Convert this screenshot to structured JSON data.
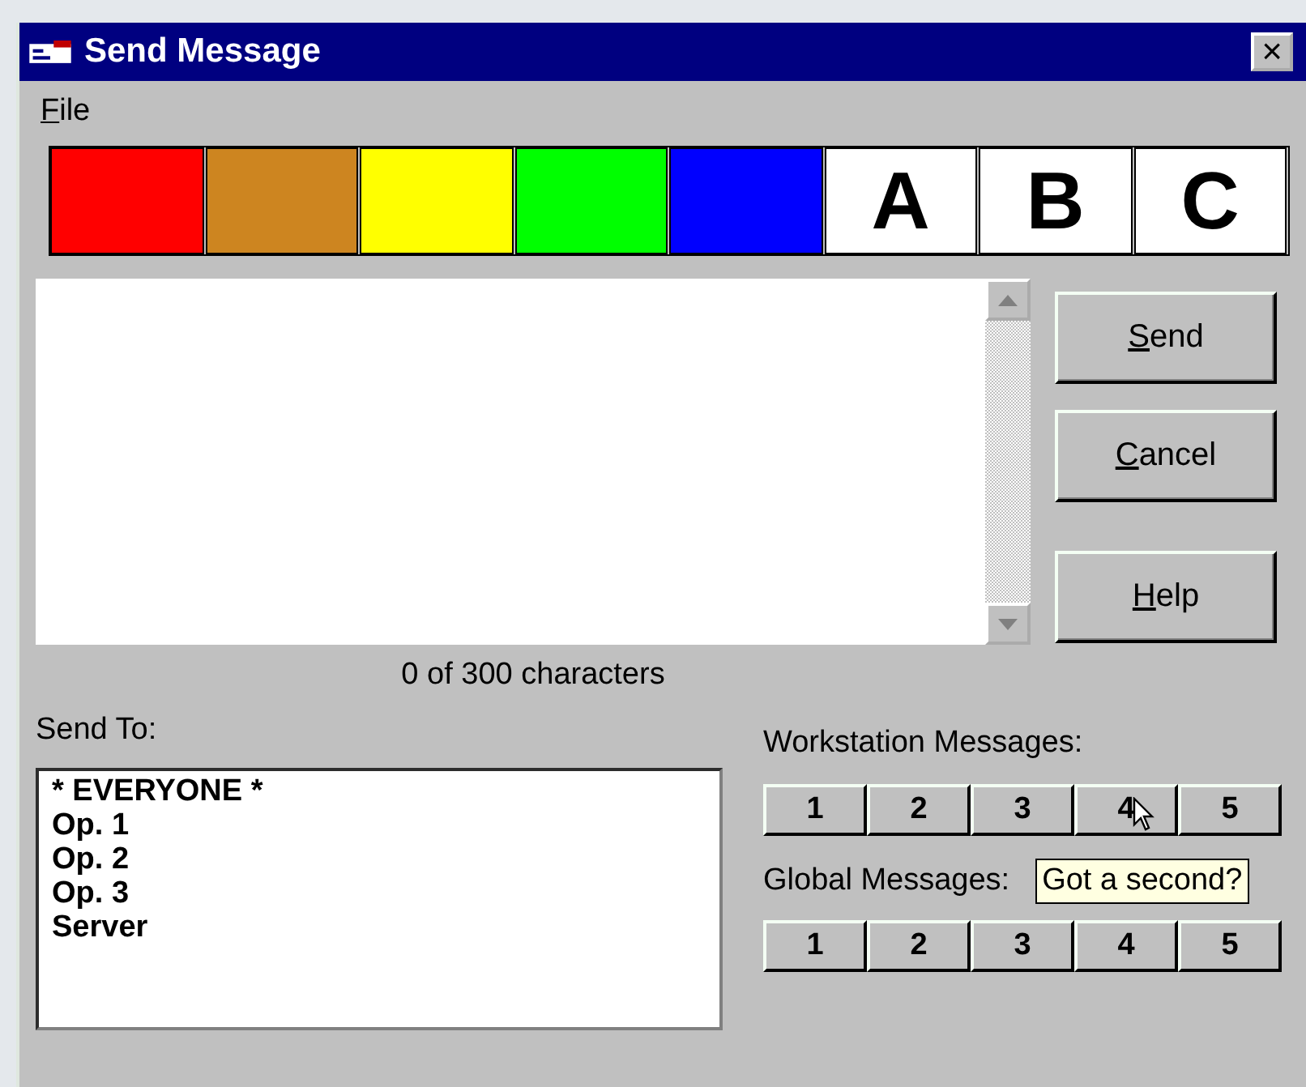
{
  "window": {
    "title": "Send Message",
    "close": "×"
  },
  "menu": [
    {
      "mnemonic": "F",
      "rest": "ile"
    }
  ],
  "palette": [
    {
      "kind": "color",
      "color": "#ff0000"
    },
    {
      "kind": "color",
      "color": "#cd8520"
    },
    {
      "kind": "color",
      "color": "#ffff00"
    },
    {
      "kind": "color",
      "color": "#00ff00"
    },
    {
      "kind": "color",
      "color": "#0000ff"
    },
    {
      "kind": "letter",
      "text": "A"
    },
    {
      "kind": "letter",
      "text": "B"
    },
    {
      "kind": "letter",
      "text": "C"
    }
  ],
  "counter": "0 of 300 characters",
  "buttons": [
    {
      "mnemonic": "S",
      "rest": "end"
    },
    {
      "mnemonic": "C",
      "rest": "ancel"
    },
    {
      "mnemonic": "H",
      "rest": "elp"
    }
  ],
  "send_to": {
    "label": "Send To:",
    "items": [
      "* EVERYONE *",
      "Op. 1",
      "Op. 2",
      "Op. 3",
      "Server"
    ]
  },
  "workstation": {
    "label": "Workstation Messages:",
    "buttons": [
      "1",
      "2",
      "3",
      "4",
      "5"
    ]
  },
  "global": {
    "label": "Global Messages:",
    "buttons": [
      "1",
      "2",
      "3",
      "4",
      "5"
    ]
  },
  "tooltip": "Got a second?"
}
